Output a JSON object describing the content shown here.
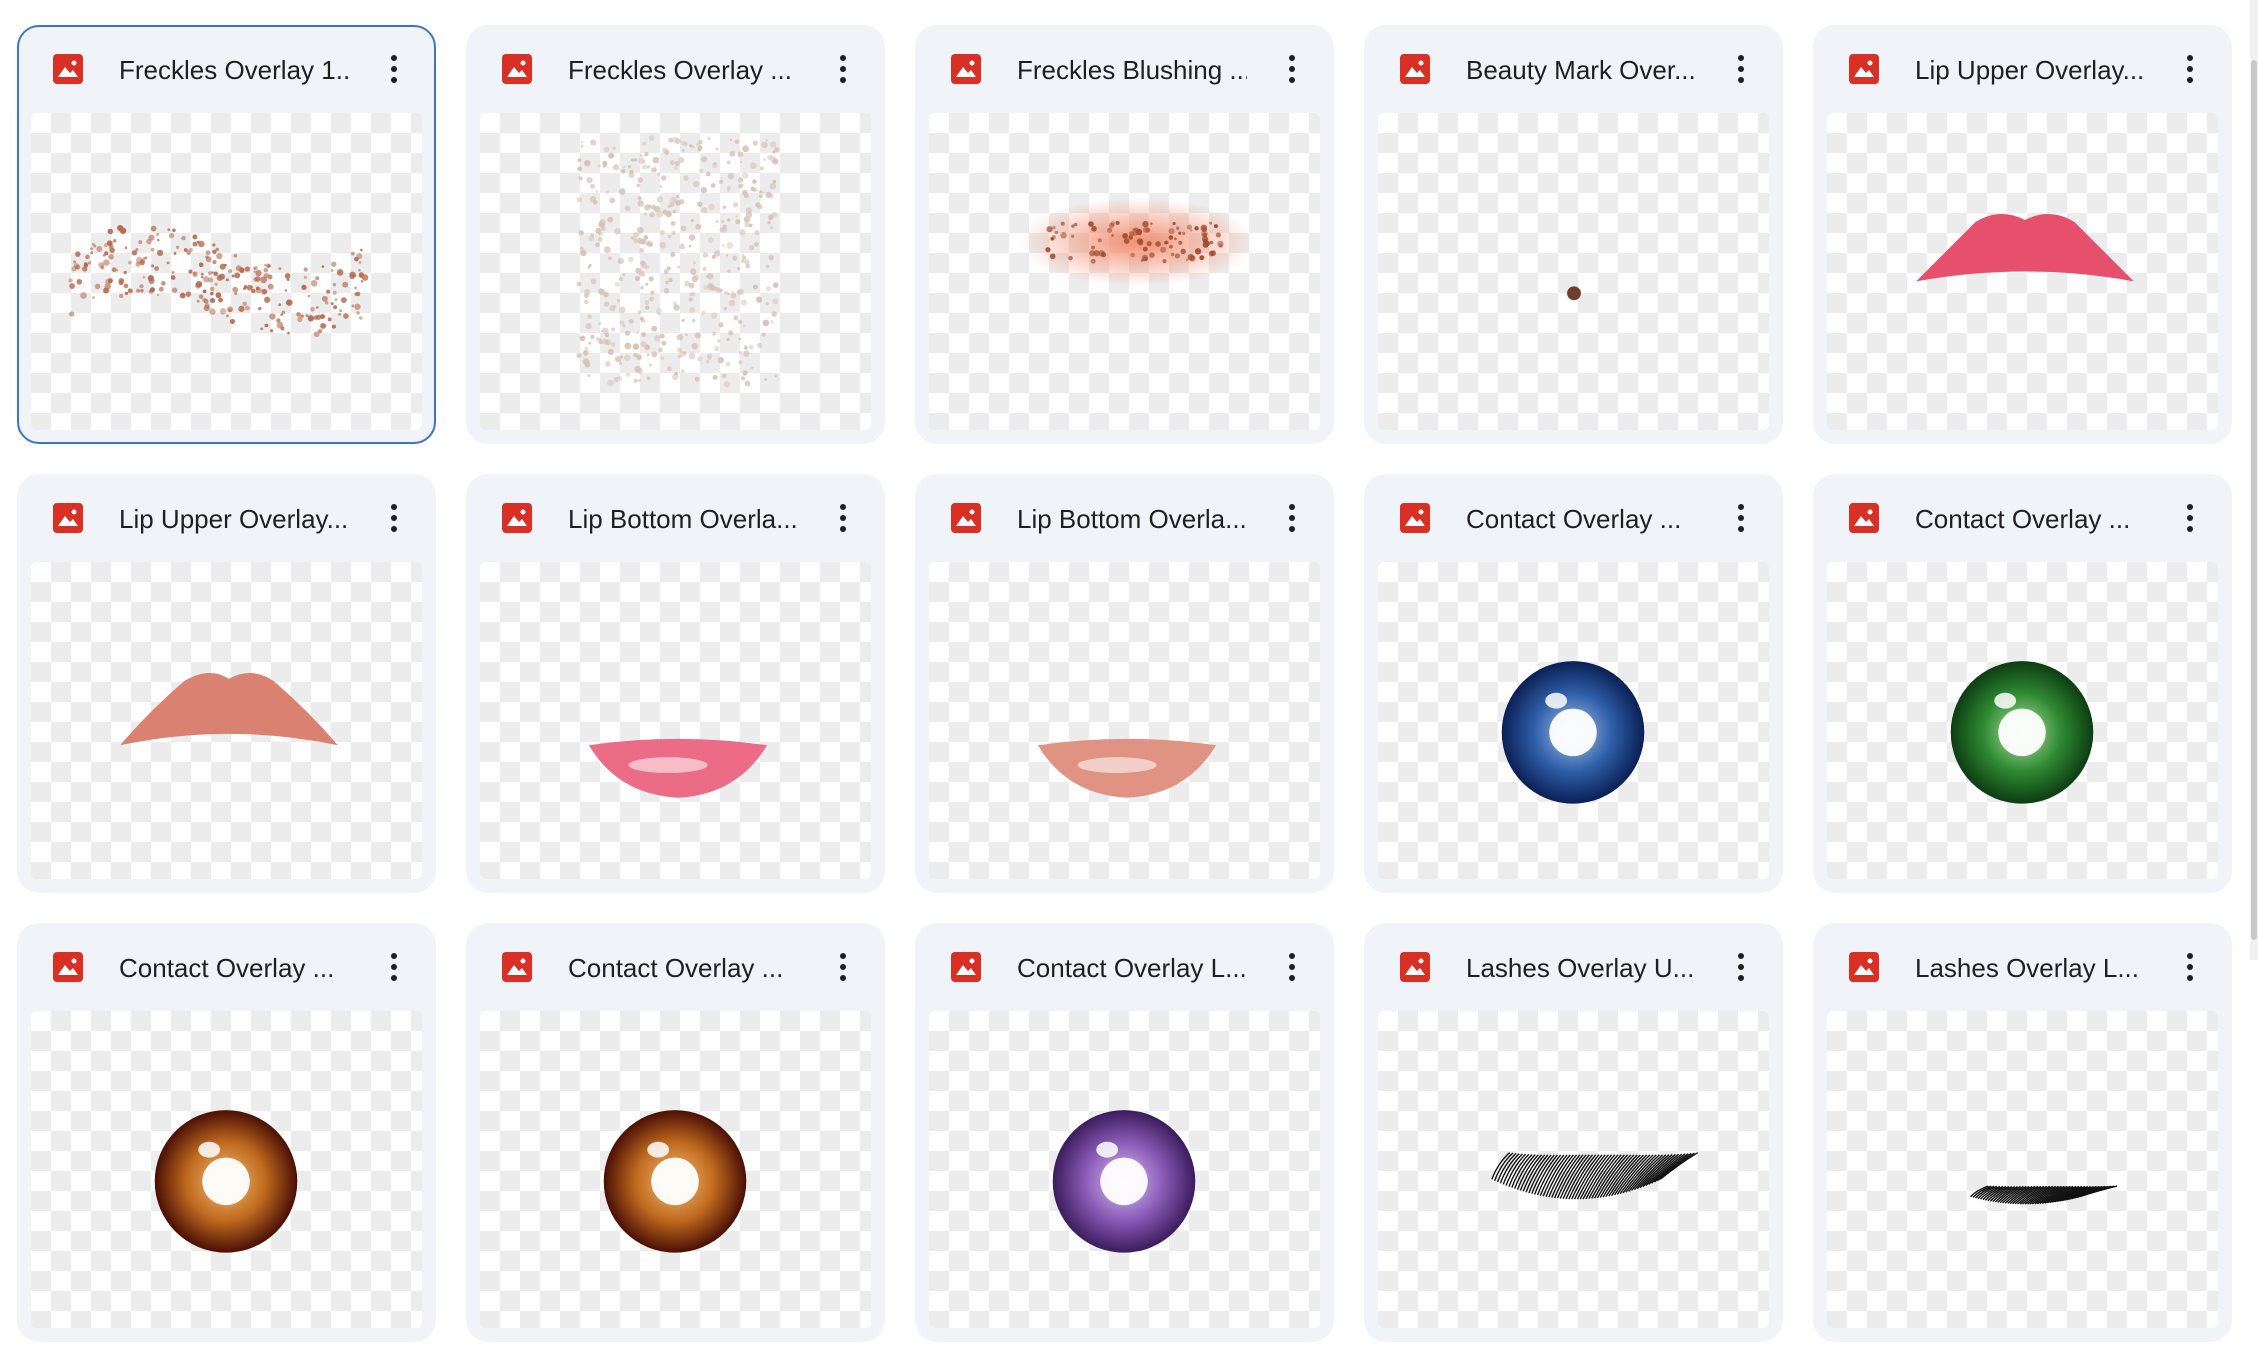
{
  "files": [
    {
      "name": "Freckles Overlay 1...",
      "preview": "freckles-band-icon",
      "selected": true
    },
    {
      "name": "Freckles Overlay ...",
      "preview": "freckles-faint-icon"
    },
    {
      "name": "Freckles Blushing ...",
      "preview": "freckles-blush-icon"
    },
    {
      "name": "Beauty Mark Over...",
      "preview": "beauty-mark-icon"
    },
    {
      "name": "Lip Upper Overlay...",
      "preview": "lip-upper-pink-icon"
    },
    {
      "name": "Lip Upper Overlay...",
      "preview": "lip-upper-nude-icon"
    },
    {
      "name": "Lip Bottom Overla...",
      "preview": "lip-bottom-pink-icon"
    },
    {
      "name": "Lip Bottom Overla...",
      "preview": "lip-bottom-nude-icon"
    },
    {
      "name": "Contact Overlay ...",
      "preview": "eye-blue-icon"
    },
    {
      "name": "Contact Overlay ...",
      "preview": "eye-green-icon"
    },
    {
      "name": "Contact Overlay ...",
      "preview": "eye-brown-icon"
    },
    {
      "name": "Contact Overlay ...",
      "preview": "eye-hazel-icon"
    },
    {
      "name": "Contact Overlay L...",
      "preview": "eye-purple-icon"
    },
    {
      "name": "Lashes Overlay U...",
      "preview": "lashes-upper-icon"
    },
    {
      "name": "Lashes Overlay L...",
      "preview": "lashes-lower-icon"
    }
  ],
  "colors": {
    "file_icon": "#d93025",
    "card_bg": "#f0f4f9",
    "selected_border": "#3f73c9"
  }
}
